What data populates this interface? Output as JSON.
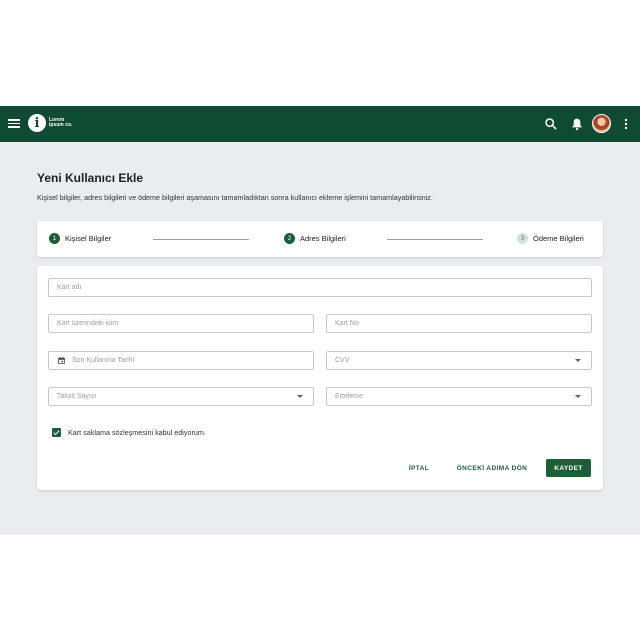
{
  "header": {
    "logo_text": "Lorem ipsum co.",
    "icons": [
      "menu-icon",
      "search-icon",
      "bell-icon",
      "avatar",
      "more-vert-icon"
    ]
  },
  "page": {
    "title": "Yeni Kullanıcı Ekle",
    "description": "Kişisel bilgiler, adres bilgileri ve ödeme bilgileri aşamasını tamamladıktan sonra kullanıcı ekleme işlemini tamamlayabilirsiniz."
  },
  "stepper": {
    "steps": [
      {
        "number": "1",
        "label": "Kişisel Bilgiler"
      },
      {
        "number": "2",
        "label": "Adres Bilgileri"
      },
      {
        "number": "3",
        "label": "Ödeme Bilgileri"
      }
    ]
  },
  "form": {
    "card_name": {
      "placeholder": "Kart adı"
    },
    "card_holder": {
      "placeholder": "Kart üzerindeki isim"
    },
    "card_number": {
      "placeholder": "Kart No"
    },
    "expiry": {
      "placeholder": "Son Kullanma Tarihi"
    },
    "cvv": {
      "placeholder": "CVV"
    },
    "installments": {
      "placeholder": "Taksit Sayısı"
    },
    "deferral": {
      "placeholder": "Erteleme"
    },
    "agreement_label": "Kart saklama sözleşmesini kabul ediyorum.",
    "agreement_checked": true
  },
  "actions": {
    "cancel": "İPTAL",
    "back": "ÖNCEKİ ADIMA DÖN",
    "save": "KAYDET"
  },
  "colors": {
    "brand": "#0f4a32",
    "accent": "#1b5e37",
    "background": "#e9edf0"
  }
}
